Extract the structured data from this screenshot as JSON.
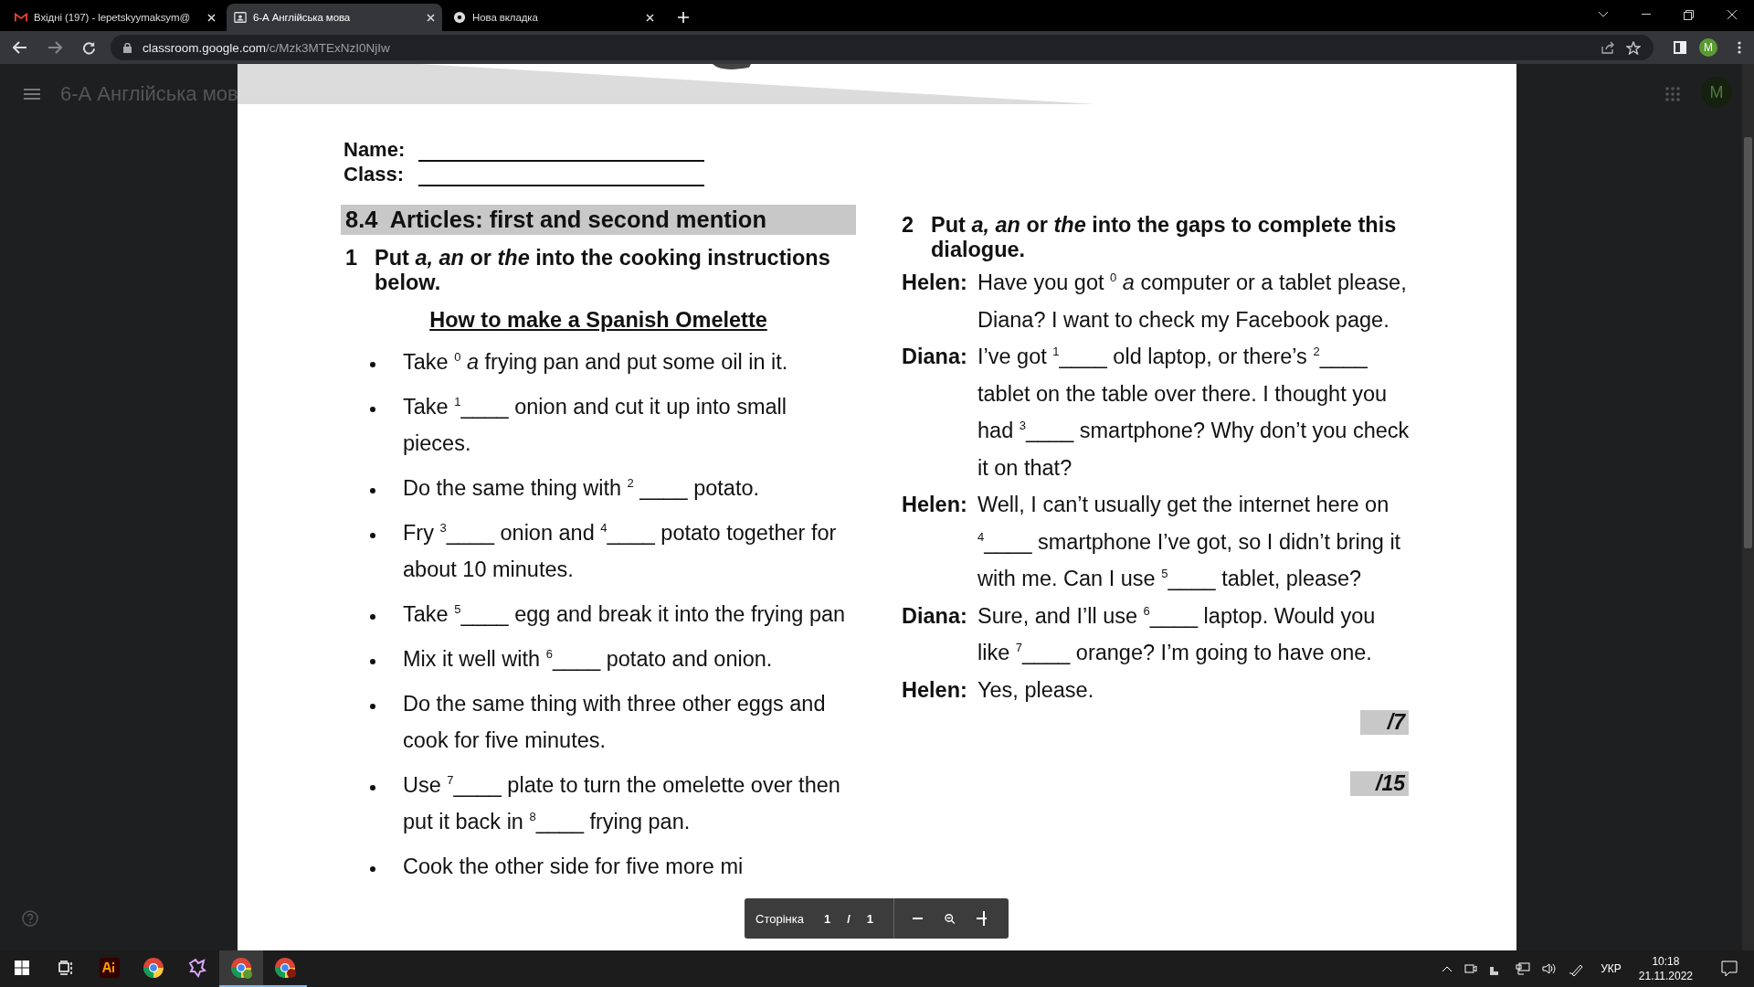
{
  "browser": {
    "tabs": [
      {
        "kind": "mail",
        "title": "Вхідні (197) - lepetskyymaksym@",
        "selected": false
      },
      {
        "kind": "classroom",
        "title": "6-А Англійська мова",
        "selected": true
      },
      {
        "kind": "chrome",
        "title": "Нова вкладка",
        "selected": false
      }
    ],
    "url_host": "classroom.google.com",
    "url_path": "/c/Mzk3MTExNzI0NjIw",
    "profile_initial": "M"
  },
  "classroom": {
    "course_title": "6-А Англійська мов",
    "avatar_initial": "M"
  },
  "worksheet": {
    "fields": [
      {
        "label": "Name:"
      },
      {
        "label": "Class:"
      }
    ],
    "section_title": "8.4  Articles: first and second mention",
    "exercise_1": {
      "number": "1",
      "instruction": "Put *a, an* or *the* into the cooking instructions below.",
      "subtitle": "How to make a Spanish Omelette",
      "items": [
        "Take $^{0}$ *a* frying pan and put some oil in it.",
        "Take $^{1}$____ onion and cut it up into small pieces.",
        "Do the same thing with $^{2}$ ____ potato.",
        "Fry $^{3}$____ onion and $^{4}$____ potato together for about 10 minutes.",
        "Take $^{5}$____ egg and break it into the frying pan",
        "Mix it well with $^{6}$____ potato and onion.",
        "Do the same thing with three other eggs and cook for five minutes.",
        "Use $^{7}$____ plate to turn the omelette over then put it back in $^{8}$____ frying pan.",
        "Cook the other side for five more mi"
      ]
    },
    "exercise_2": {
      "number": "2",
      "instruction": "Put *a, an* or *the* into the gaps to complete this dialogue.",
      "dialogue": [
        {
          "speaker": "Helen:",
          "line": "Have you got $^{0}$ *a* computer or a tablet please, Diana? I want to check my Facebook page."
        },
        {
          "speaker": "Diana:",
          "line": "I’ve got $^{1}$____ old laptop, or there’s $^{2}$____ tablet on the table over there. I thought you had $^{3}$____ smartphone? Why don’t you check it on that?"
        },
        {
          "speaker": "Helen:",
          "line": "Well, I can’t usually get the internet here on $^{4}$____ smartphone I’ve got, so I didn’t bring it with me. Can I use $^{5}$____ tablet, please?"
        },
        {
          "speaker": "Diana:",
          "line": "Sure, and I’ll use $^{6}$____ laptop. Would you like $^{7}$____ orange? I’m going to have one."
        },
        {
          "speaker": "Helen:",
          "line": "Yes, please."
        }
      ],
      "score": "/7"
    },
    "total_score": "/15"
  },
  "viewer_toolbar": {
    "page_label": "Сторінка",
    "page": "1",
    "separator": "/",
    "total": "1"
  },
  "taskbar": {
    "apps": [
      {
        "kind": "start",
        "open": false,
        "selected": false
      },
      {
        "kind": "task-view",
        "open": false,
        "selected": false
      },
      {
        "kind": "illustrator",
        "open": false,
        "selected": false
      },
      {
        "kind": "chrome",
        "open": false,
        "selected": false
      },
      {
        "kind": "app",
        "open": false,
        "selected": false
      },
      {
        "kind": "chrome-profile",
        "open": true,
        "selected": true
      },
      {
        "kind": "chrome-other",
        "open": true,
        "selected": false
      }
    ],
    "language": "УКР",
    "time": "10:18",
    "date": "21.11.2022"
  }
}
